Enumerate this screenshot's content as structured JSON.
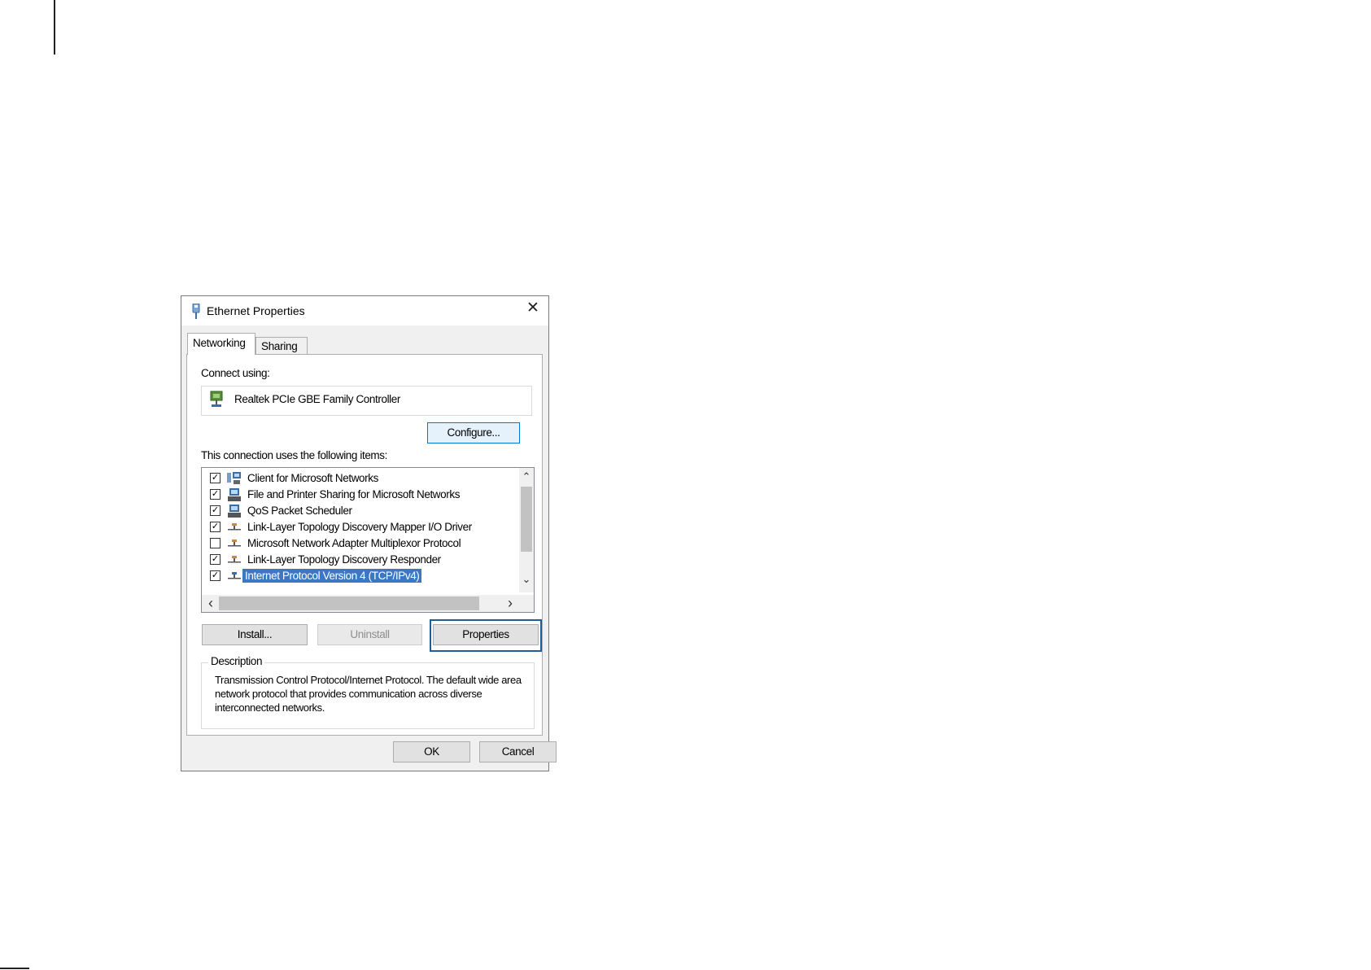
{
  "dialog": {
    "title": "Ethernet Properties",
    "close_label": "✕",
    "tabs": [
      {
        "label": "Networking",
        "active": true
      },
      {
        "label": "Sharing",
        "active": false
      }
    ],
    "connect_using_label": "Connect using:",
    "adapter_name": "Realtek PCIe GBE Family Controller",
    "configure_button": "Configure...",
    "items_label": "This connection uses the following items:",
    "items": [
      {
        "label": "Client for Microsoft Networks",
        "checked": true,
        "icon": "network-client-icon"
      },
      {
        "label": "File and Printer Sharing for Microsoft Networks",
        "checked": true,
        "icon": "network-service-icon"
      },
      {
        "label": "QoS Packet Scheduler",
        "checked": true,
        "icon": "network-service-icon"
      },
      {
        "label": "Link-Layer Topology Discovery Mapper I/O Driver",
        "checked": true,
        "icon": "network-protocol-icon"
      },
      {
        "label": "Microsoft Network Adapter Multiplexor Protocol",
        "checked": false,
        "icon": "network-protocol-icon"
      },
      {
        "label": "Link-Layer Topology Discovery Responder",
        "checked": true,
        "icon": "network-protocol-icon"
      },
      {
        "label": "Internet Protocol Version 4 (TCP/IPv4)",
        "checked": true,
        "icon": "network-protocol-icon",
        "selected": true
      }
    ],
    "install_button": "Install...",
    "uninstall_button": "Uninstall",
    "properties_button": "Properties",
    "description_legend": "Description",
    "description_text": "Transmission Control Protocol/Internet Protocol. The default wide area network protocol that provides communication across diverse interconnected networks.",
    "ok_button": "OK",
    "cancel_button": "Cancel",
    "scroll_up": "⌃",
    "scroll_down": "⌄",
    "scroll_left": "‹",
    "scroll_right": "›"
  },
  "colors": {
    "selection": "#3a78c5",
    "focus_border": "#0078d7",
    "highlight_frame": "#1f5d99"
  }
}
